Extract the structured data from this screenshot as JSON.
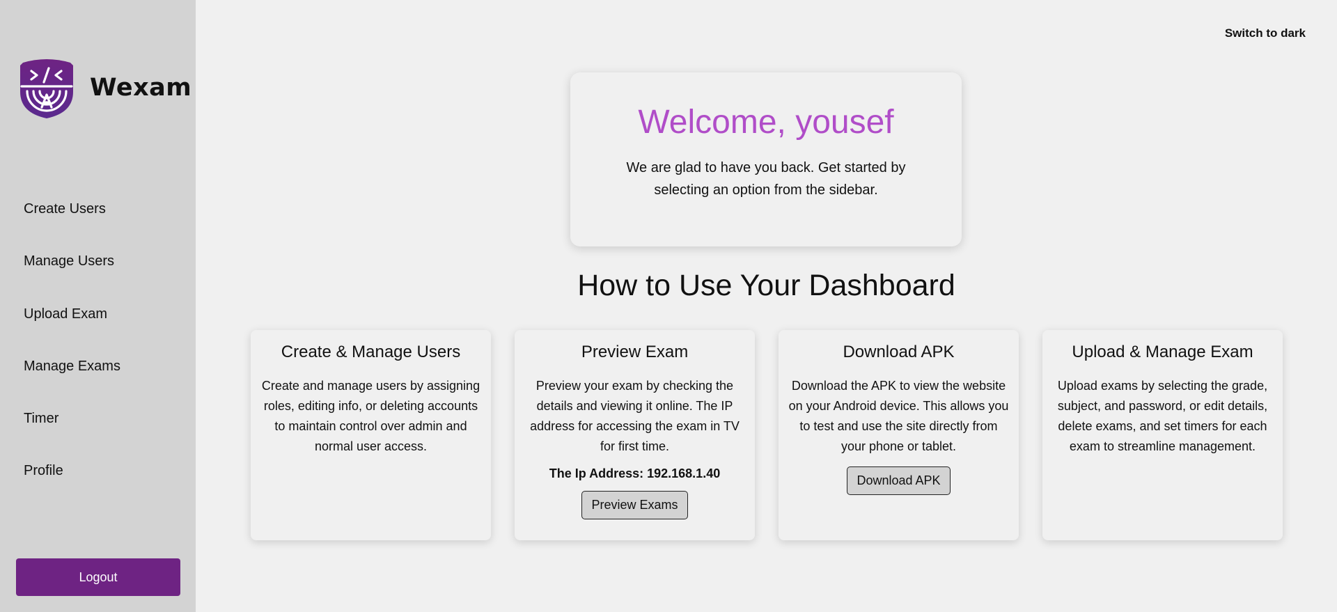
{
  "sidebar": {
    "brand_name": "Wexam",
    "items": [
      {
        "label": "Create Users"
      },
      {
        "label": "Manage Users"
      },
      {
        "label": "Upload Exam"
      },
      {
        "label": "Manage Exams"
      },
      {
        "label": "Timer"
      },
      {
        "label": "Profile"
      }
    ],
    "logout_label": "Logout"
  },
  "header": {
    "theme_toggle_label": "Switch to dark"
  },
  "welcome": {
    "title": "Welcome, yousef",
    "message": "We are glad to have you back. Get started by selecting an option from the sidebar."
  },
  "guide": {
    "title": "How to Use Your Dashboard",
    "cards": [
      {
        "title": "Create & Manage Users",
        "text": "Create and manage users by assigning roles, editing info, or deleting accounts to maintain control over admin and normal user access."
      },
      {
        "title": "Preview Exam",
        "text": "Preview your exam by checking the details and viewing it online. The IP address for accessing the exam in TV for first time.",
        "ip_text": "The Ip Address: 192.168.1.40",
        "button_label": "Preview Exams"
      },
      {
        "title": "Download APK",
        "text": "Download the APK to view the website on your Android device. This allows you to test and use the site directly from your phone or tablet.",
        "button_label": "Download APK"
      },
      {
        "title": "Upload & Manage Exam",
        "text": "Upload exams by selecting the grade, subject, and password, or edit details, delete exams, and set timers for each exam to streamline management."
      }
    ]
  },
  "colors": {
    "accent": "#6e2383",
    "welcome_title": "#b04dc8",
    "sidebar_bg": "#d3d3d3",
    "page_bg": "#f0f0f0"
  },
  "icons": {
    "logo": "shield-code-logo-icon"
  }
}
